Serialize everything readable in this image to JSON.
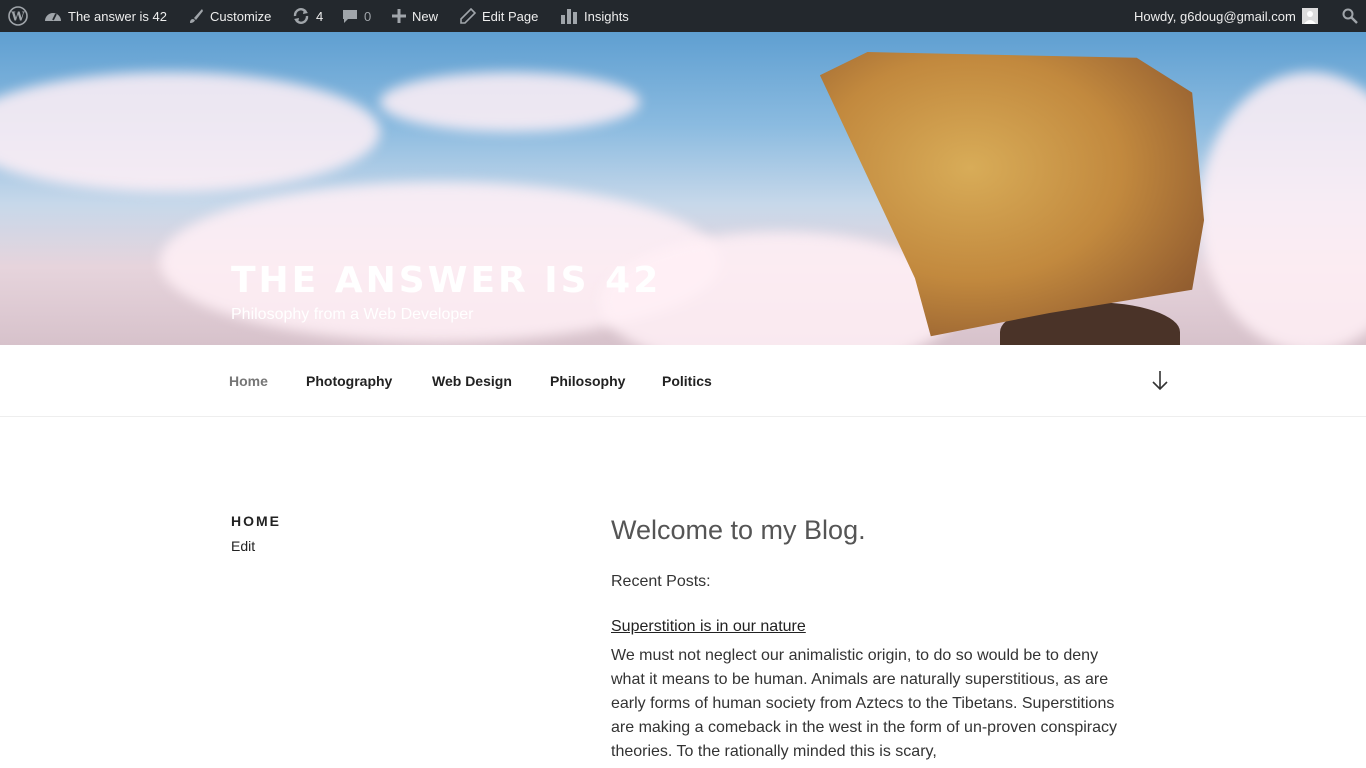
{
  "admin_bar": {
    "site_name": "The answer is 42",
    "customize": "Customize",
    "updates_count": "4",
    "comments_count": "0",
    "new_label": "New",
    "edit_page": "Edit Page",
    "insights": "Insights",
    "howdy": "Howdy, g6doug@gmail.com"
  },
  "header": {
    "site_title": "THE ANSWER IS 42",
    "site_description": "Philosophy from a Web Developer"
  },
  "nav": {
    "items": [
      {
        "label": "Home",
        "current": true
      },
      {
        "label": "Photography"
      },
      {
        "label": "Web Design"
      },
      {
        "label": "Philosophy"
      },
      {
        "label": "Politics"
      }
    ]
  },
  "page": {
    "title": "HOME",
    "edit_label": "Edit"
  },
  "entry": {
    "heading": "Welcome to my Blog.",
    "recent_label": "Recent Posts:",
    "post_title": "Superstition is in our nature",
    "post_excerpt": "We must not neglect our animalistic origin, to do so would be to deny what it means to be human. Animals are naturally superstitious, as are early forms of human society from Aztecs to the Tibetans. Superstitions are making a comeback in the west in the form of un-proven conspiracy theories. To the rationally minded this is scary,"
  },
  "icons": [
    "wordpress-icon",
    "dashboard-icon",
    "brush-icon",
    "update-icon",
    "comment-icon",
    "plus-icon",
    "pencil-icon",
    "bar-chart-icon",
    "avatar",
    "search-icon",
    "arrow-down-icon"
  ]
}
